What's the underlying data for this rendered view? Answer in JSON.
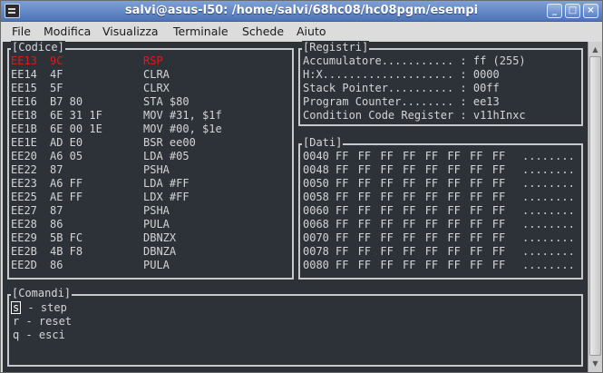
{
  "window": {
    "title": "salvi@asus-l50: /home/salvi/68hc08/hc08pgm/esempi",
    "buttons": [
      "_",
      "□",
      "×"
    ]
  },
  "menu": [
    "File",
    "Modifica",
    "Visualizza",
    "Terminale",
    "Schede",
    "Aiuto"
  ],
  "codice": {
    "title": "[Codice]",
    "rows": [
      {
        "addr": "EE13",
        "bytes": "9C",
        "instr": "RSP",
        "current": true
      },
      {
        "addr": "EE14",
        "bytes": "4F",
        "instr": "CLRA"
      },
      {
        "addr": "EE15",
        "bytes": "5F",
        "instr": "CLRX"
      },
      {
        "addr": "EE16",
        "bytes": "B7 80",
        "instr": "STA $80"
      },
      {
        "addr": "EE18",
        "bytes": "6E 31 1F",
        "instr": "MOV #31, $1f"
      },
      {
        "addr": "EE1B",
        "bytes": "6E 00 1E",
        "instr": "MOV #00, $1e"
      },
      {
        "addr": "EE1E",
        "bytes": "AD E0",
        "instr": "BSR ee00"
      },
      {
        "addr": "EE20",
        "bytes": "A6 05",
        "instr": "LDA #05"
      },
      {
        "addr": "EE22",
        "bytes": "87",
        "instr": "PSHA"
      },
      {
        "addr": "EE23",
        "bytes": "A6 FF",
        "instr": "LDA #FF"
      },
      {
        "addr": "EE25",
        "bytes": "AE FF",
        "instr": "LDX #FF"
      },
      {
        "addr": "EE27",
        "bytes": "87",
        "instr": "PSHA"
      },
      {
        "addr": "EE28",
        "bytes": "86",
        "instr": "PULA"
      },
      {
        "addr": "EE29",
        "bytes": "5B FC",
        "instr": "DBNZX"
      },
      {
        "addr": "EE2B",
        "bytes": "4B F8",
        "instr": "DBNZA"
      },
      {
        "addr": "EE2D",
        "bytes": "86",
        "instr": "PULA"
      }
    ]
  },
  "registri": {
    "title": "[Registri]",
    "rows": [
      {
        "label": "Accumulatore........... : ",
        "value": "ff (255)"
      },
      {
        "label": "H:X.................... : ",
        "value": "0000"
      },
      {
        "label": "Stack Pointer.......... : ",
        "value": "00ff"
      },
      {
        "label": "Program Counter........ : ",
        "value": "ee13"
      },
      {
        "label": "Condition Code Register : ",
        "value": "v11hInxc"
      }
    ]
  },
  "dati": {
    "title": "[Dati]",
    "rows": [
      {
        "addr": "0040",
        "bytes": "FF FF FF FF FF FF FF FF",
        "ascii": "........"
      },
      {
        "addr": "0048",
        "bytes": "FF FF FF FF FF FF FF FF",
        "ascii": "........"
      },
      {
        "addr": "0050",
        "bytes": "FF FF FF FF FF FF FF FF",
        "ascii": "........"
      },
      {
        "addr": "0058",
        "bytes": "FF FF FF FF FF FF FF FF",
        "ascii": "........"
      },
      {
        "addr": "0060",
        "bytes": "FF FF FF FF FF FF FF FF",
        "ascii": "........"
      },
      {
        "addr": "0068",
        "bytes": "FF FF FF FF FF FF FF FF",
        "ascii": "........"
      },
      {
        "addr": "0070",
        "bytes": "FF FF FF FF FF FF FF FF",
        "ascii": "........"
      },
      {
        "addr": "0078",
        "bytes": "FF FF FF FF FF FF FF FF",
        "ascii": "........"
      },
      {
        "addr": "0080",
        "bytes": "FF FF FF FF FF FF FF FF",
        "ascii": "........"
      }
    ]
  },
  "comandi": {
    "title": "[Comandi]",
    "items": [
      {
        "key": "s",
        "desc": " - step"
      },
      {
        "key": "r",
        "desc": " - reset"
      },
      {
        "key": "q",
        "desc": " - esci"
      }
    ]
  },
  "colors": {
    "terminal_bg": "#2d3238",
    "terminal_fg": "#d4d4d4",
    "highlight": "#d81c1c",
    "titlebar": "#5a7fc0"
  }
}
